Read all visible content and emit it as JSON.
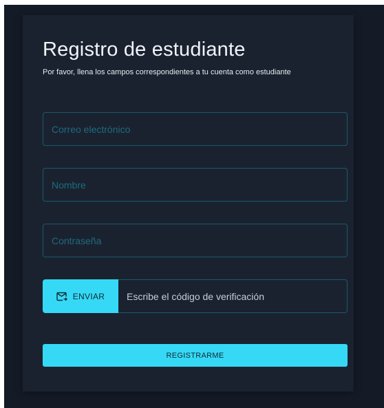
{
  "form": {
    "title": "Registro de estudiante",
    "subtitle": "Por favor, llena los campos correspondientes a tu cuenta como estudiante",
    "email": {
      "placeholder": "Correo electrónico",
      "value": ""
    },
    "name": {
      "placeholder": "Nombre",
      "value": ""
    },
    "password": {
      "placeholder": "Contraseña",
      "value": ""
    },
    "verification": {
      "send_label": "ENVIAR",
      "send_icon": "send-mail-icon",
      "placeholder": "Escribe el código de verificación",
      "value": ""
    },
    "register_label": "REGISTRARME"
  },
  "colors": {
    "page_background": "#141b27",
    "card_background": "#1a2230",
    "accent": "#35d9f5",
    "field_border": "#1c5a6a",
    "placeholder": "#1f6b7f"
  }
}
